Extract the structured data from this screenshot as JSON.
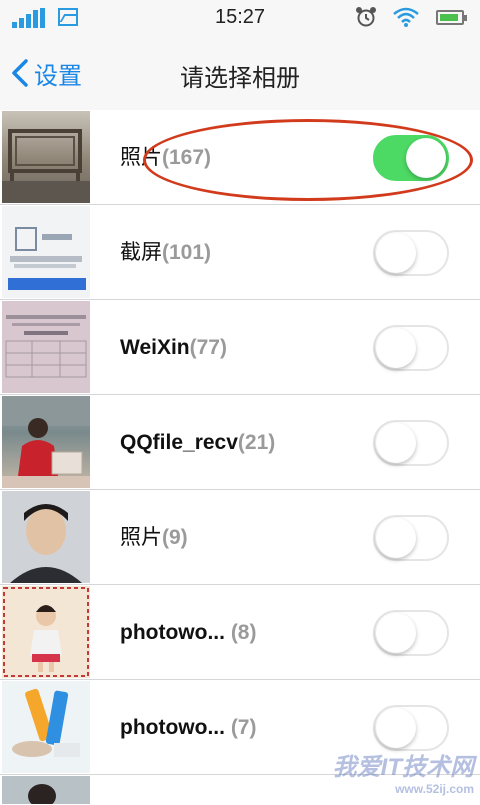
{
  "status_bar": {
    "time": "15:27",
    "icons": [
      "signal-icon",
      "photo-icon",
      "alarm-icon",
      "wifi-icon",
      "battery-icon"
    ],
    "battery_level": 0.9,
    "accent_color": "#2a9be0"
  },
  "nav": {
    "back_label": "设置",
    "title": "请选择相册"
  },
  "albums": [
    {
      "name": "照片",
      "count": "(167)",
      "enabled": true
    },
    {
      "name": "截屏",
      "count": "(101)",
      "enabled": false
    },
    {
      "name": "WeiXin",
      "count": "(77)",
      "enabled": false
    },
    {
      "name": "QQfile_recv",
      "count": "(21)",
      "enabled": false
    },
    {
      "name": "照片",
      "count": "(9)",
      "enabled": false
    },
    {
      "name": "photowo...",
      "count": " (8)",
      "enabled": false
    },
    {
      "name": "photowo...",
      "count": " (7)",
      "enabled": false
    }
  ],
  "colors": {
    "toggle_on": "#4cd964",
    "link": "#1a86e6",
    "annotation": "#d23a1c"
  },
  "watermark": {
    "text": "我爱IT技术网",
    "sub": "www.52ij.com"
  }
}
